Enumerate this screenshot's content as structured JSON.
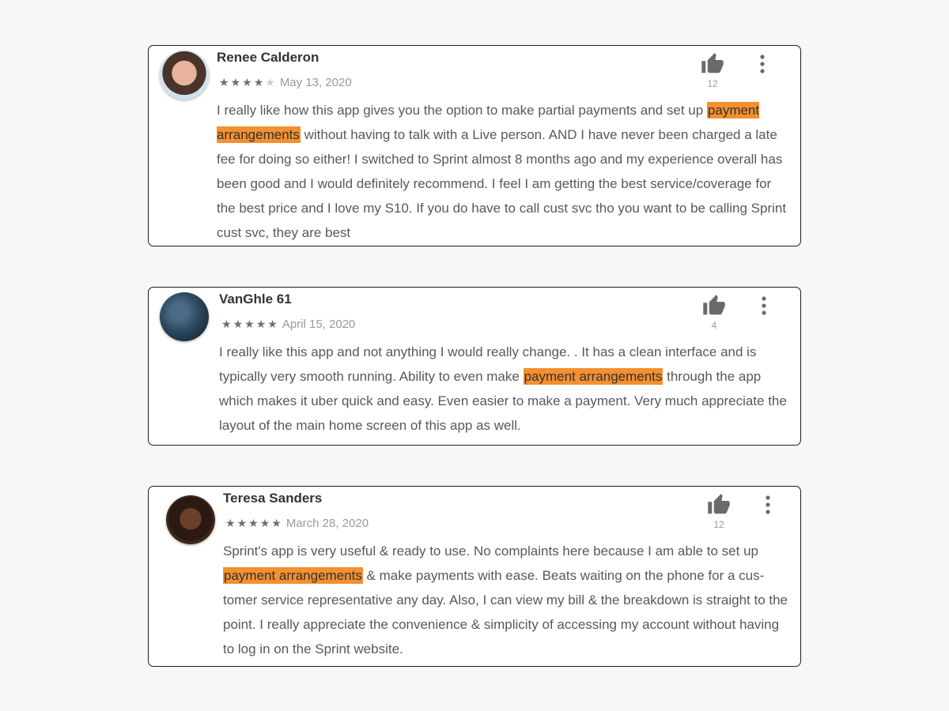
{
  "reviews": [
    {
      "name": "Renee Calderon",
      "rating": 4,
      "rating_max": 5,
      "date": "May 13, 2020",
      "likes": "12",
      "body": {
        "before": "I really like how this app gives you the option to make partial payments and set up ",
        "highlight": "payment arrangements",
        "after": " without having to talk with a Live person. AND I have never been charged a late fee for doing so either! I switched to Sprint almost 8 months ago and my experience overall has been good and I would definitely recommend. I feel I am getting the best service/coverage for the best price and I love my S10. If you do have to call cust svc tho you want to be calling Sprint cust svc, they are best"
      }
    },
    {
      "name": "VanGhle 61",
      "rating": 5,
      "rating_max": 5,
      "date": "April 15, 2020",
      "likes": "4",
      "body": {
        "before": "I really like this app and not anything I would really change. . It has a clean interface and is typically very smooth running. Ability to even make ",
        "highlight": "payment arrangements",
        "after": " through the app which makes it uber quick and easy. Even easier to make a payment. Very much appreciate the layout of the main home screen of this app as well."
      }
    },
    {
      "name": "Teresa Sanders",
      "rating": 5,
      "rating_max": 5,
      "date": "March 28, 2020",
      "likes": "12",
      "body": {
        "before": "Sprint's app is very useful & ready to use. No complaints here because I am able to set up ",
        "highlight": "payment arrangements",
        "after": " & make payments with ease. Beats waiting on the phone for a cus-tomer service representative any day. Also, I can view my bill & the breakdown is straight to the point. I really appreciate the convenience & simplicity of accessing my account without having to log in on the Sprint website."
      }
    }
  ],
  "icons": {
    "like": "thumbs-up-icon",
    "more": "more-vertical-icon",
    "star": "star-icon"
  },
  "colors": {
    "highlight": "#f4902f",
    "star": "#6e6e6e",
    "star_empty": "#cfcfcf",
    "icon": "#6a6a6a"
  }
}
